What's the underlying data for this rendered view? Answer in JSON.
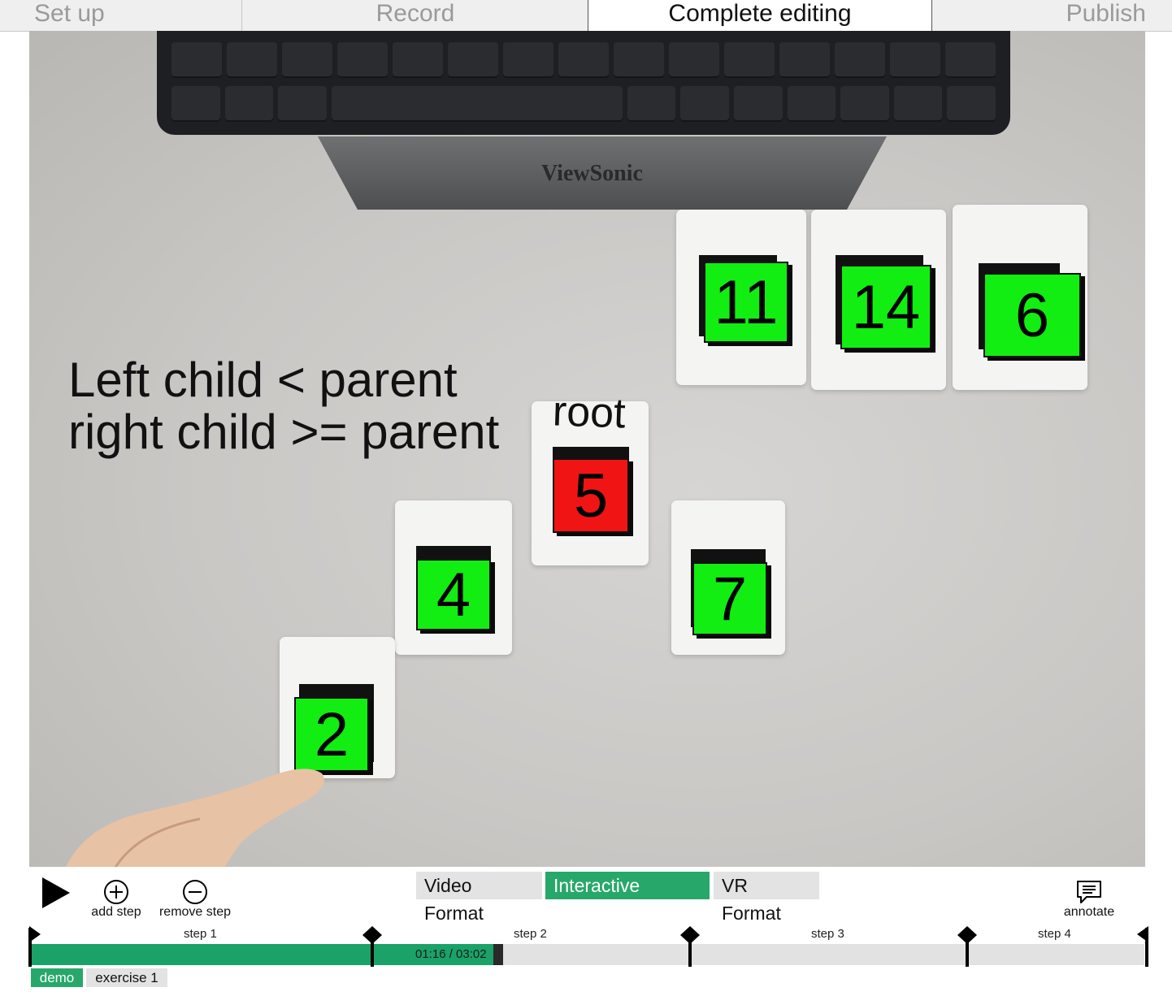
{
  "tabs": {
    "setup": "Set up",
    "record": "Record",
    "complete_editing": "Complete editing",
    "publish": "Publish",
    "active": "complete_editing"
  },
  "video": {
    "overlay_line1": "Left child < parent",
    "overlay_line2": "right child >= parent",
    "root_label": "root",
    "monitor_brand": "ViewSonic",
    "cubes": [
      {
        "label": "11",
        "color": "#12ee12"
      },
      {
        "label": "14",
        "color": "#12ee12"
      },
      {
        "label": "6",
        "color": "#12ee12"
      },
      {
        "label": "5",
        "color": "#f01414"
      },
      {
        "label": "4",
        "color": "#12ee12"
      },
      {
        "label": "7",
        "color": "#12ee12"
      },
      {
        "label": "2",
        "color": "#12ee12"
      }
    ]
  },
  "controls": {
    "add_step": "add step",
    "remove_step": "remove step",
    "annotate": "annotate"
  },
  "formats": {
    "video": "Video Format",
    "interactive": "Interactive Format",
    "vr": "VR Format",
    "selected": "interactive"
  },
  "timeline": {
    "steps": [
      "step 1",
      "step 2",
      "step 3",
      "step 4"
    ],
    "time": "01:16 / 03:02",
    "progress_fraction": 0.42,
    "accent": "#1aa268"
  },
  "modes": {
    "demo": "demo",
    "exercise": "exercise 1",
    "selected": "demo"
  }
}
